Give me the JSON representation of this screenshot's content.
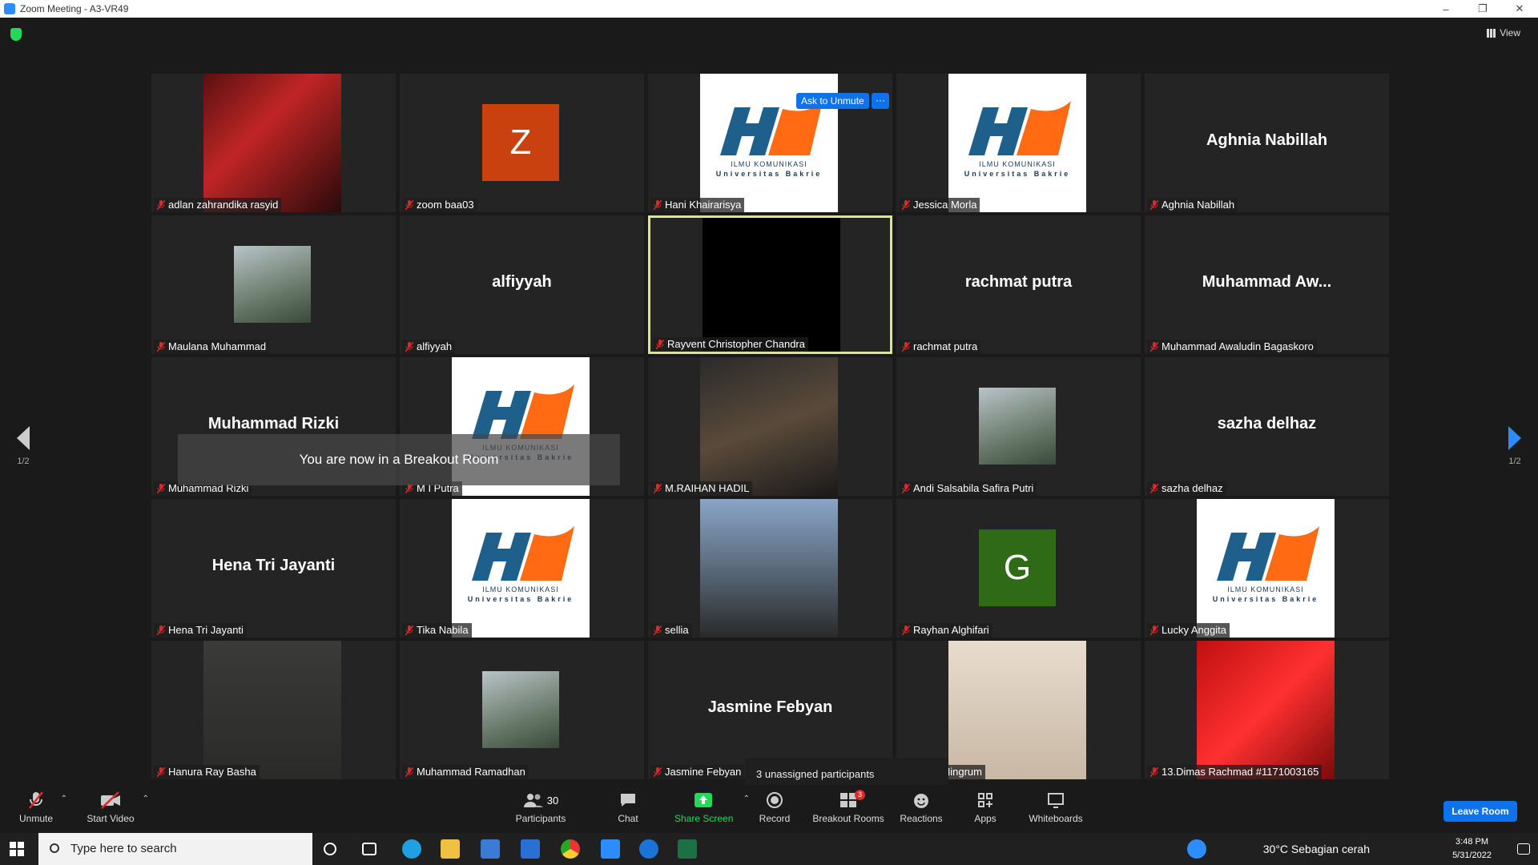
{
  "window": {
    "title": "Zoom Meeting - A3-VR49"
  },
  "header": {
    "view_label": "View"
  },
  "ask_unmute_label": "Ask to Unmute",
  "more_label": "···",
  "toast": "You are now in a Breakout Room",
  "page_indicator": "1/2",
  "unassigned_text": "3 unassigned participants",
  "tiles": [
    {
      "label": "adlan zahrandika rasyid",
      "display": "photo"
    },
    {
      "label": "zoom baa03",
      "display": "avatar",
      "avatar_letter": "Z",
      "avatar_color": "#c9410f"
    },
    {
      "label": "Hani Khairarisya",
      "display": "logo"
    },
    {
      "label": "Jessica Morla",
      "display": "logo"
    },
    {
      "label": "Aghnia Nabillah",
      "display": "name",
      "name_text": "Aghnia Nabillah"
    },
    {
      "label": "Maulana Muhammad",
      "display": "thumb"
    },
    {
      "label": "alfiyyah",
      "display": "name",
      "name_text": "alfiyyah"
    },
    {
      "label": "Rayvent Christopher Chandra",
      "display": "black",
      "active_speaker": true
    },
    {
      "label": "rachmat putra",
      "display": "name",
      "name_text": "rachmat putra"
    },
    {
      "label": "Muhammad Awaludin Bagaskoro",
      "display": "name",
      "name_text": "Muhammad  Aw..."
    },
    {
      "label": "Muhammad Rizki",
      "display": "name",
      "name_text": "Muhammad Rizki"
    },
    {
      "label": "M I Putra",
      "display": "logo"
    },
    {
      "label": "M.RAIHAN HADIL",
      "display": "photo"
    },
    {
      "label": "Andi Salsabila Safira Putri",
      "display": "thumb"
    },
    {
      "label": "sazha delhaz",
      "display": "name",
      "name_text": "sazha delhaz"
    },
    {
      "label": "Hena Tri Jayanti",
      "display": "name",
      "name_text": "Hena Tri Jayanti"
    },
    {
      "label": "Tika Nabila",
      "display": "logo"
    },
    {
      "label": "sellia",
      "display": "photo"
    },
    {
      "label": "Rayhan Alghifari",
      "display": "avatar",
      "avatar_letter": "G",
      "avatar_color": "#2f6b16"
    },
    {
      "label": "Lucky Anggita",
      "display": "logo"
    },
    {
      "label": "Hanura Ray Basha",
      "display": "photo"
    },
    {
      "label": "Muhammad Ramadhan",
      "display": "thumb"
    },
    {
      "label": "Jasmine Febyan",
      "display": "name",
      "name_text": "Jasmine Febyan"
    },
    {
      "label": "rmata Ningrum",
      "display": "photo"
    },
    {
      "label": "13.Dimas Rachmad #1171003165",
      "display": "photo"
    }
  ],
  "logo_text": {
    "line1": "ILMU KOMUNIKASI",
    "line2": "Universitas Bakrie"
  },
  "toolbar": {
    "unmute": "Unmute",
    "start_video": "Start Video",
    "participants": "Participants",
    "participants_count": "30",
    "chat": "Chat",
    "share_screen": "Share Screen",
    "record": "Record",
    "breakout_rooms": "Breakout Rooms",
    "breakout_badge": "3",
    "reactions": "Reactions",
    "apps": "Apps",
    "whiteboards": "Whiteboards",
    "leave_room": "Leave Room"
  },
  "taskbar": {
    "search_placeholder": "Type here to search",
    "weather": "30°C  Sebagian cerah",
    "time": "3:48 PM",
    "date": "5/31/2022"
  },
  "colors": {
    "accent": "#0e72ed",
    "share": "#23d959",
    "active_border": "#dbe87a"
  }
}
